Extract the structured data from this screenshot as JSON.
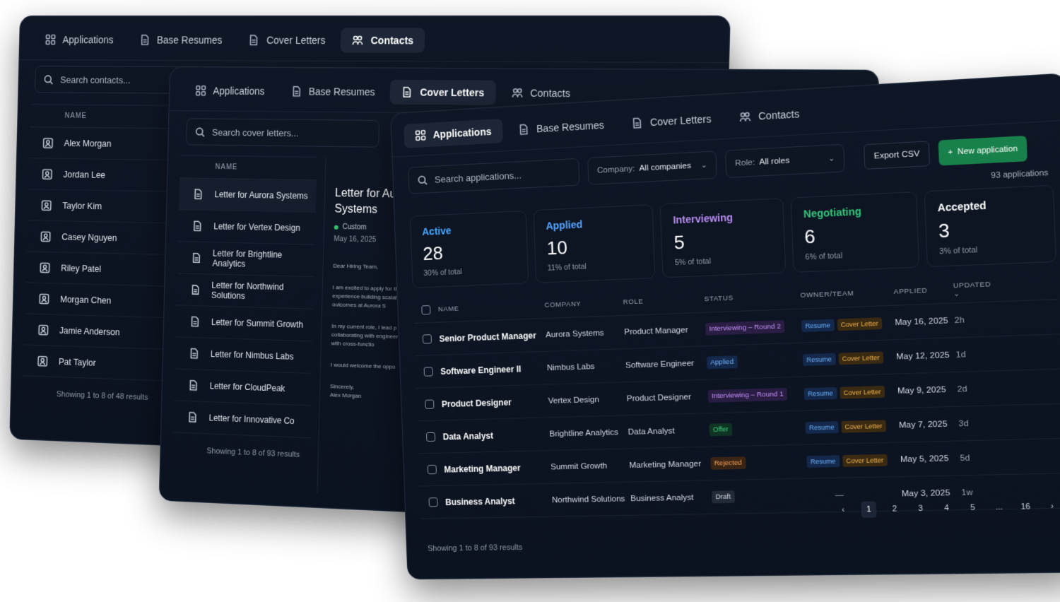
{
  "tabs": {
    "applications": "Applications",
    "base_resumes": "Base Resumes",
    "cover_letters": "Cover Letters",
    "contacts": "Contacts"
  },
  "contacts_panel": {
    "search_placeholder": "Search contacts...",
    "column_name": "NAME",
    "contacts": [
      "Alex Morgan",
      "Jordan Lee",
      "Taylor Kim",
      "Casey Nguyen",
      "Riley Patel",
      "Morgan Chen",
      "Jamie Anderson",
      "Pat Taylor"
    ],
    "showing": "Showing 1 to 8 of 48 results"
  },
  "cover_letters_panel": {
    "search_placeholder": "Search cover letters...",
    "column_name": "NAME",
    "letters": [
      "Letter for Aurora Systems",
      "Letter for Vertex Design",
      "Letter for Brightline Analytics",
      "Letter for Northwind Solutions",
      "Letter for Summit Growth",
      "Letter for Nimbus Labs",
      "Letter for CloudPeak",
      "Letter for Innovative Co"
    ],
    "showing": "Showing 1 to 8 of 93 results",
    "preview": {
      "title": "Letter for Aurora Systems",
      "tag": "Custom",
      "date": "May 16, 2025",
      "greeting": "Dear Hiring Team,",
      "para1": "I am excited to apply for the experience building scalable user outcomes at Aurora S",
      "para2": "In my current role, I lead p collaborating with engineer closely with cross-functio",
      "para3": "I would welcome the oppo",
      "signoff": "Sincerely,",
      "signature": "Alex Morgan"
    }
  },
  "applications_panel": {
    "search_placeholder": "Search applications...",
    "company_filter": {
      "label": "Company:",
      "value": "All companies"
    },
    "role_filter": {
      "label": "Role:",
      "value": "All roles"
    },
    "export_label": "Export CSV",
    "new_label": "New application",
    "count": "93 applications",
    "stats": [
      {
        "label": "Active",
        "value": "28",
        "sub": "30% of total",
        "color": "#4aa8ff"
      },
      {
        "label": "Applied",
        "value": "10",
        "sub": "11% of total",
        "color": "#5aa7ff"
      },
      {
        "label": "Interviewing",
        "value": "5",
        "sub": "5% of total",
        "color": "#b98cf2"
      },
      {
        "label": "Negotiating",
        "value": "6",
        "sub": "6% of total",
        "color": "#34c77b"
      },
      {
        "label": "Accepted",
        "value": "3",
        "sub": "3% of total",
        "color": "#ffffff"
      }
    ],
    "columns": {
      "name": "NAME",
      "company": "COMPANY",
      "role": "ROLE",
      "status": "STATUS",
      "owner": "OWNER/TEAM",
      "applied": "APPLIED",
      "updated": "UPDATED"
    },
    "rows": [
      {
        "name": "Senior Product Manager",
        "company": "Aurora Systems",
        "role": "Product Manager",
        "status": "Interviewing – Round 2",
        "status_kind": "int",
        "resume": "Resume",
        "cover": "Cover Letter",
        "applied": "May 16, 2025",
        "updated": "2h"
      },
      {
        "name": "Software Engineer II",
        "company": "Nimbus Labs",
        "role": "Software Engineer",
        "status": "Applied",
        "status_kind": "app",
        "resume": "Resume",
        "cover": "Cover Letter",
        "applied": "May 12, 2025",
        "updated": "1d"
      },
      {
        "name": "Product Designer",
        "company": "Vertex Design",
        "role": "Product Designer",
        "status": "Interviewing – Round 1",
        "status_kind": "int",
        "resume": "Resume",
        "cover": "Cover Letter",
        "applied": "May 9, 2025",
        "updated": "2d"
      },
      {
        "name": "Data Analyst",
        "company": "Brightline Analytics",
        "role": "Data Analyst",
        "status": "Offer",
        "status_kind": "off",
        "resume": "Resume",
        "cover": "Cover Letter",
        "applied": "May 7, 2025",
        "updated": "3d"
      },
      {
        "name": "Marketing Manager",
        "company": "Summit Growth",
        "role": "Marketing Manager",
        "status": "Rejected",
        "status_kind": "rej",
        "resume": "Resume",
        "cover": "Cover Letter",
        "applied": "May 5, 2025",
        "updated": "5d"
      },
      {
        "name": "Business Analyst",
        "company": "Northwind Solutions",
        "role": "Business Analyst",
        "status": "Draft",
        "status_kind": "draft",
        "owner_empty": "—",
        "applied": "May 3, 2025",
        "updated": "1w"
      }
    ],
    "pagination": {
      "prev": "‹",
      "pages": [
        "1",
        "2",
        "3",
        "4",
        "5"
      ],
      "ellipsis": "...",
      "last": "16",
      "next": "›"
    },
    "showing": "Showing 1 to 8 of 93 results"
  }
}
